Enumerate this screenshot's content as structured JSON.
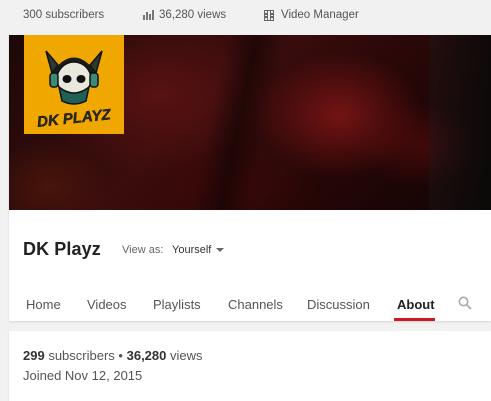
{
  "topbar": {
    "subscribers": "300 subscribers",
    "views": "36,280 views",
    "video_manager": "Video Manager"
  },
  "logo": {
    "text": "DK PLAYZ",
    "icon": "skull-logo-icon",
    "bg_color": "#f0a800"
  },
  "channel": {
    "name": "DK Playz",
    "view_as_label": "View as:",
    "view_as_value": "Yourself"
  },
  "tabs": [
    {
      "label": "Home"
    },
    {
      "label": "Videos"
    },
    {
      "label": "Playlists"
    },
    {
      "label": "Channels"
    },
    {
      "label": "Discussion"
    },
    {
      "label": "About",
      "active": true
    }
  ],
  "about": {
    "subscribers_count": "299",
    "subscribers_word": "subscribers",
    "separator": "•",
    "views_count": "36,280",
    "views_word": "views",
    "joined": "Joined Nov 12, 2015"
  },
  "colors": {
    "accent": "#cc181e",
    "page_bg": "#f1f1f1"
  }
}
